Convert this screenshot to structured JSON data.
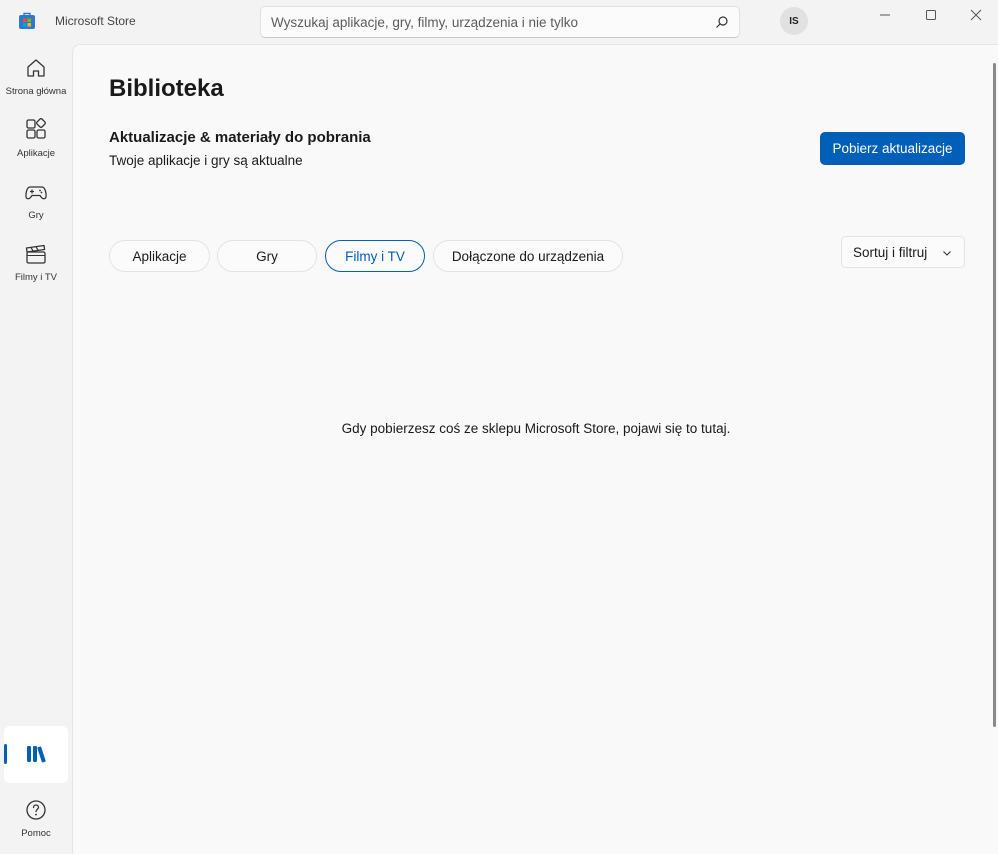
{
  "app": {
    "title": "Microsoft Store"
  },
  "search": {
    "placeholder": "Wyszukaj aplikacje, gry, filmy, urządzenia i nie tylko",
    "value": ""
  },
  "user": {
    "initials": "IS"
  },
  "sidebar": {
    "items": [
      {
        "label": "Strona główna",
        "icon": "home-icon"
      },
      {
        "label": "Aplikacje",
        "icon": "apps-icon"
      },
      {
        "label": "Gry",
        "icon": "gamepad-icon"
      },
      {
        "label": "Filmy i TV",
        "icon": "clapperboard-icon"
      }
    ],
    "library_icon": "library-icon",
    "help": {
      "label": "Pomoc",
      "icon": "help-icon"
    }
  },
  "main": {
    "title": "Biblioteka",
    "updates": {
      "title": "Aktualizacje & materiały do pobrania",
      "status": "Twoje aplikacje i gry są aktualne",
      "button_label": "Pobierz aktualizacje"
    },
    "tabs": [
      {
        "label": "Aplikacje",
        "active": false
      },
      {
        "label": "Gry",
        "active": false
      },
      {
        "label": "Filmy i TV",
        "active": true
      },
      {
        "label": "Dołączone do urządzenia",
        "active": false
      }
    ],
    "sort_label": "Sortuj i filtruj",
    "empty_message": "Gdy pobierzesz coś ze sklepu Microsoft Store, pojawi się to tutaj."
  },
  "colors": {
    "accent": "#005fb8",
    "background": "#f3f3f3",
    "panel": "#f9f9f9"
  }
}
